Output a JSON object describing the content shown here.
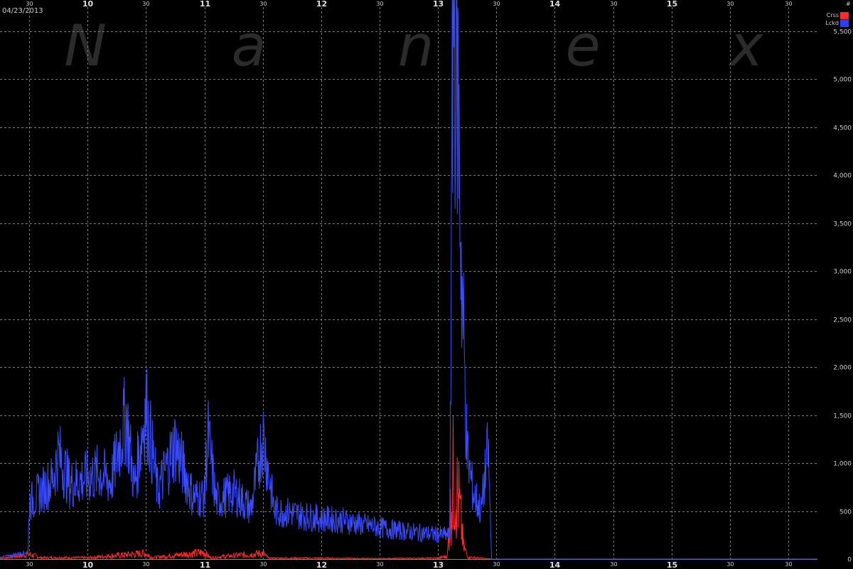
{
  "date_label": "04/23/2013",
  "watermark": [
    "N",
    "a",
    "n",
    "e",
    "x"
  ],
  "unit_label": "#",
  "colors": {
    "background": "#000000",
    "grid": "#8a8a8a",
    "crossed": "#ff2a2a",
    "locked": "#3a4cff",
    "watermark": "#2b2b2b"
  },
  "legend": [
    {
      "label": "Crss",
      "color": "#ff2a2a"
    },
    {
      "label": "Lckd",
      "color": "#2a40ff"
    }
  ],
  "chart_data": {
    "type": "line",
    "title": "",
    "xlabel": "",
    "ylabel": "",
    "x_unit": "hour of day",
    "xlim": [
      9.25,
      16.25
    ],
    "ylim": [
      0,
      5750
    ],
    "x_ticks_major": [
      {
        "value": 10,
        "label": "10"
      },
      {
        "value": 11,
        "label": "11"
      },
      {
        "value": 12,
        "label": "12"
      },
      {
        "value": 13,
        "label": "13"
      },
      {
        "value": 14,
        "label": "14"
      },
      {
        "value": 15,
        "label": "15"
      }
    ],
    "x_ticks_minor": [
      {
        "value": 9.5,
        "label": "30"
      },
      {
        "value": 10.5,
        "label": "30"
      },
      {
        "value": 11.5,
        "label": "30"
      },
      {
        "value": 12.5,
        "label": "30"
      },
      {
        "value": 13.5,
        "label": "30"
      },
      {
        "value": 14.5,
        "label": "30"
      },
      {
        "value": 15.5,
        "label": "30"
      },
      {
        "value": 16.0,
        "label": "30"
      }
    ],
    "y_ticks": [
      {
        "value": 0,
        "label": "0"
      },
      {
        "value": 500,
        "label": "500"
      },
      {
        "value": 1000,
        "label": "1,000"
      },
      {
        "value": 1500,
        "label": "1,500"
      },
      {
        "value": 2000,
        "label": "2,000"
      },
      {
        "value": 2500,
        "label": "2,500"
      },
      {
        "value": 3000,
        "label": "3,000"
      },
      {
        "value": 3500,
        "label": "3,500"
      },
      {
        "value": 4000,
        "label": "4,000"
      },
      {
        "value": 4500,
        "label": "4,500"
      },
      {
        "value": 5000,
        "label": "5,000"
      },
      {
        "value": 5500,
        "label": "5,500"
      }
    ],
    "grid": true,
    "legend_position": "top-right",
    "series": [
      {
        "name": "Lckd",
        "color": "#3a4cff",
        "points": [
          [
            9.25,
            20
          ],
          [
            9.35,
            40
          ],
          [
            9.42,
            60
          ],
          [
            9.49,
            70
          ],
          [
            9.5,
            580
          ],
          [
            9.6,
            700
          ],
          [
            9.7,
            820
          ],
          [
            9.75,
            1100
          ],
          [
            9.85,
            780
          ],
          [
            10.0,
            850
          ],
          [
            10.1,
            900
          ],
          [
            10.2,
            800
          ],
          [
            10.33,
            1500
          ],
          [
            10.4,
            750
          ],
          [
            10.5,
            1600
          ],
          [
            10.6,
            700
          ],
          [
            10.75,
            1200
          ],
          [
            10.9,
            650
          ],
          [
            11.0,
            650
          ],
          [
            11.03,
            1300
          ],
          [
            11.1,
            600
          ],
          [
            11.25,
            700
          ],
          [
            11.4,
            520
          ],
          [
            11.5,
            1300
          ],
          [
            11.6,
            500
          ],
          [
            11.75,
            480
          ],
          [
            11.85,
            450
          ],
          [
            12.0,
            420
          ],
          [
            12.2,
            400
          ],
          [
            12.35,
            360
          ],
          [
            12.5,
            330
          ],
          [
            12.65,
            300
          ],
          [
            12.8,
            280
          ],
          [
            12.95,
            260
          ],
          [
            13.1,
            250
          ],
          [
            13.13,
            5750
          ],
          [
            13.17,
            5000
          ],
          [
            13.2,
            3100
          ],
          [
            13.25,
            1100
          ],
          [
            13.3,
            700
          ],
          [
            13.37,
            500
          ],
          [
            13.43,
            1150
          ],
          [
            13.46,
            0
          ],
          [
            13.5,
            0
          ],
          [
            16.25,
            0
          ]
        ]
      },
      {
        "name": "Crss",
        "color": "#ff2a2a",
        "points": [
          [
            9.25,
            5
          ],
          [
            9.5,
            50
          ],
          [
            9.6,
            15
          ],
          [
            10.0,
            15
          ],
          [
            10.5,
            60
          ],
          [
            10.55,
            15
          ],
          [
            11.0,
            70
          ],
          [
            11.05,
            15
          ],
          [
            11.5,
            60
          ],
          [
            11.55,
            10
          ],
          [
            12.0,
            10
          ],
          [
            12.5,
            5
          ],
          [
            13.0,
            10
          ],
          [
            13.08,
            30
          ],
          [
            13.13,
            850
          ],
          [
            13.18,
            600
          ],
          [
            13.22,
            120
          ],
          [
            13.26,
            20
          ],
          [
            13.46,
            0
          ],
          [
            16.25,
            0
          ]
        ]
      }
    ]
  }
}
